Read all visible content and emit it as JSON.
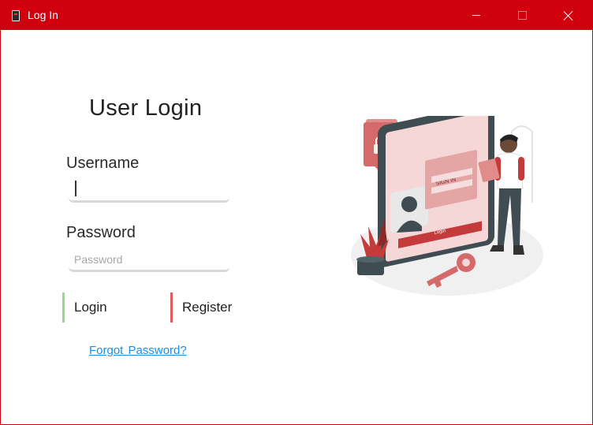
{
  "window": {
    "title": "Log In",
    "accent": "#d0000f"
  },
  "form": {
    "heading": "User Login",
    "username_label": "Username",
    "username_value": "",
    "password_label": "Password",
    "password_placeholder": "Password",
    "login_button": "Login",
    "register_button": "Register",
    "forgot_link": "Forgot  Password?"
  },
  "illustration": {
    "screen_title": "SIGN IN",
    "screen_button": "Login"
  },
  "icons": [
    "app-icon",
    "minimize-icon",
    "maximize-icon",
    "close-icon",
    "lock-icon",
    "user-icon",
    "key-icon"
  ]
}
